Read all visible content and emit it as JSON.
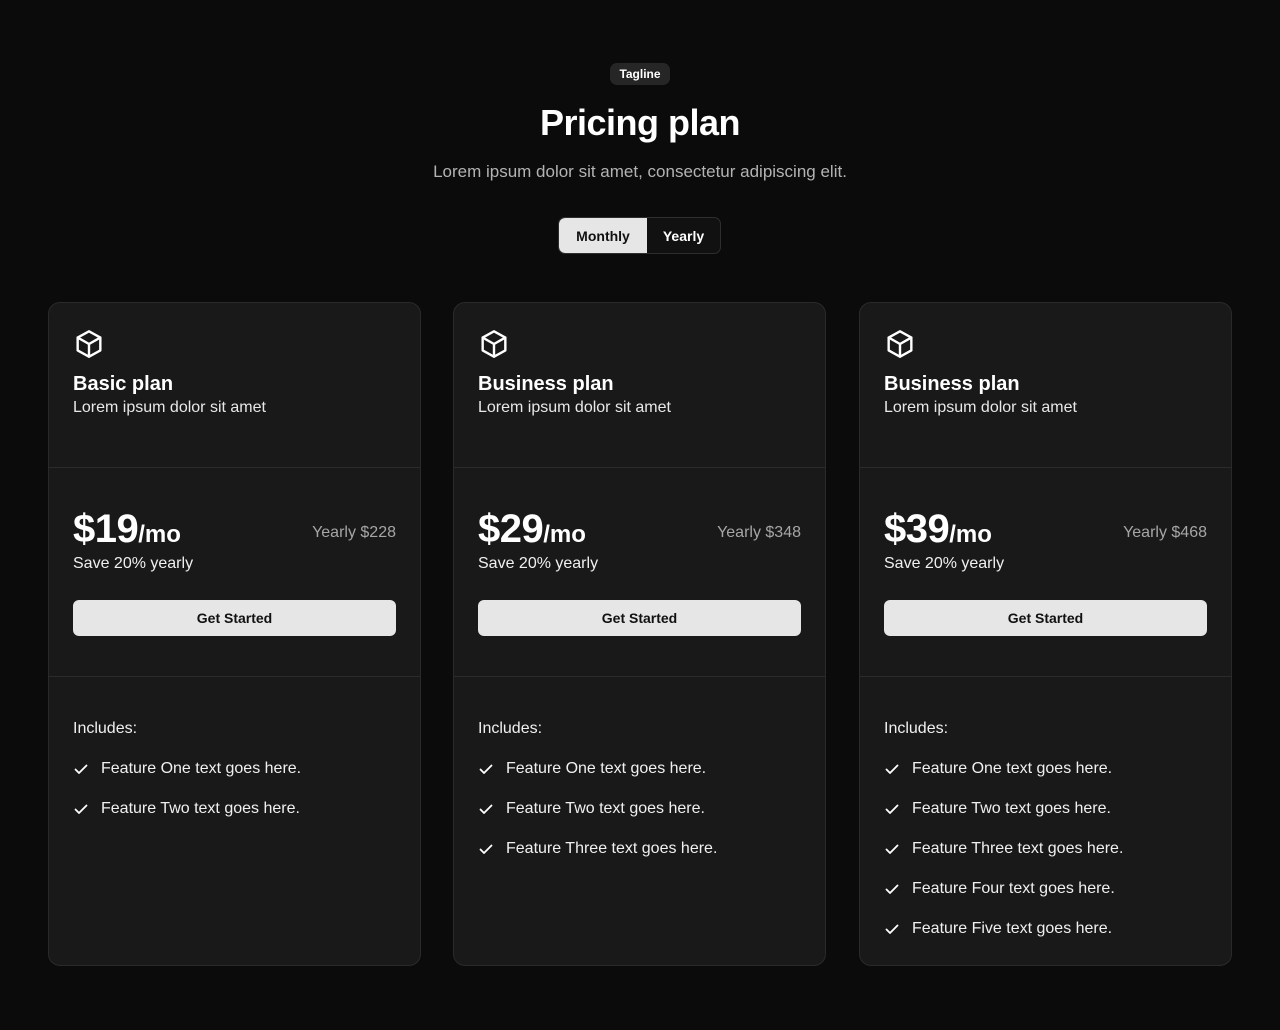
{
  "header": {
    "tagline": "Tagline",
    "title": "Pricing plan",
    "subtitle": "Lorem ipsum dolor sit amet, consectetur adipiscing elit."
  },
  "toggle": {
    "monthly": "Monthly",
    "yearly": "Yearly",
    "selected": "Monthly"
  },
  "plans": [
    {
      "name": "Basic plan",
      "description": "Lorem ipsum dolor sit amet",
      "price": "$19",
      "period": "/mo",
      "yearly": "Yearly $228",
      "save": "Save 20% yearly",
      "cta": "Get Started",
      "includes": "Includes:",
      "features": [
        "Feature One text goes here.",
        "Feature Two text goes here."
      ]
    },
    {
      "name": "Business plan",
      "description": "Lorem ipsum dolor sit amet",
      "price": "$29",
      "period": "/mo",
      "yearly": "Yearly $348",
      "save": "Save 20% yearly",
      "cta": "Get Started",
      "includes": "Includes:",
      "features": [
        "Feature One text goes here.",
        "Feature Two text goes here.",
        "Feature Three text goes here."
      ]
    },
    {
      "name": "Business plan",
      "description": "Lorem ipsum dolor sit amet",
      "price": "$39",
      "period": "/mo",
      "yearly": "Yearly $468",
      "save": "Save 20% yearly",
      "cta": "Get Started",
      "includes": "Includes:",
      "features": [
        "Feature One text goes here.",
        "Feature Two text goes here.",
        "Feature Three text goes here.",
        "Feature Four text goes here.",
        "Feature Five text goes here."
      ]
    }
  ],
  "icons": {
    "plan": "cube-icon",
    "feature": "check-icon"
  },
  "colors": {
    "background": "#0b0b0b",
    "card": "#191919",
    "button": "#e6e6e6",
    "muted_text": "#a6a6a6"
  }
}
